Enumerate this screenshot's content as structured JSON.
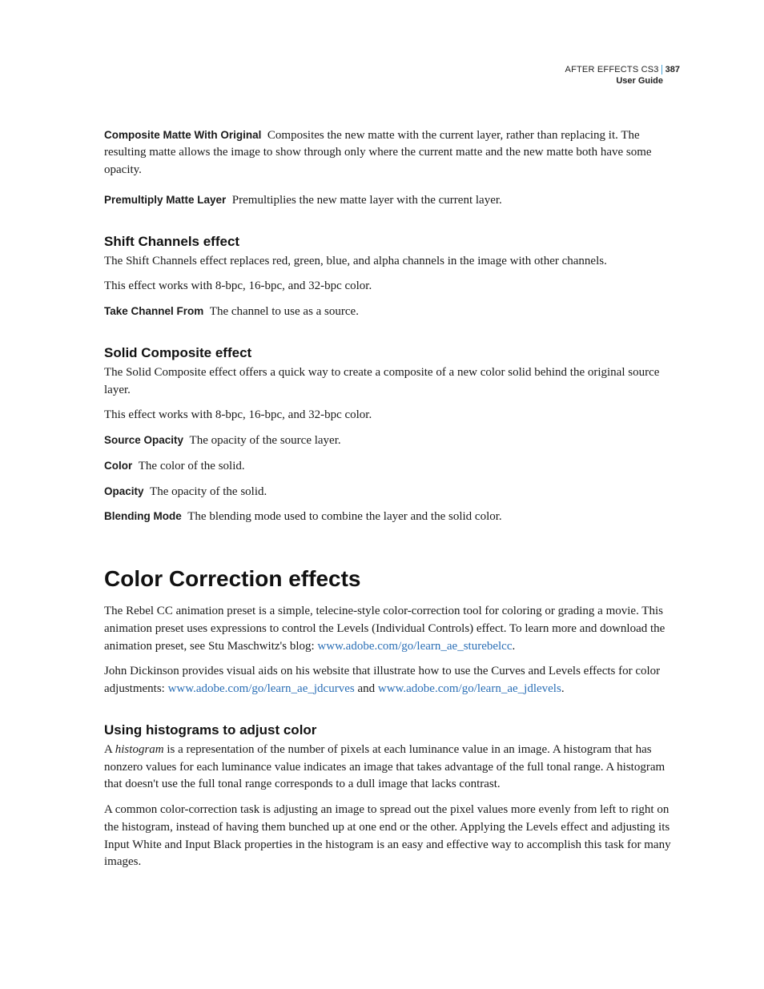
{
  "header": {
    "product": "AFTER EFFECTS CS3",
    "guide": "User Guide",
    "page_number": "387"
  },
  "intro_defs": [
    {
      "term": "Composite Matte With Original",
      "body": "Composites the new matte with the current layer, rather than replacing it. The resulting matte allows the image to show through only where the current matte and the new matte both have some opacity."
    },
    {
      "term": "Premultiply Matte Layer",
      "body": "Premultiplies the new matte layer with the current layer."
    }
  ],
  "shift_channels": {
    "title": "Shift Channels effect",
    "p1": "The Shift Channels effect replaces red, green, blue, and alpha channels in the image with other channels.",
    "p2": "This effect works with 8-bpc, 16-bpc, and 32-bpc color.",
    "defs": [
      {
        "term": "Take Channel From",
        "body": "The channel to use as a source."
      }
    ]
  },
  "solid_composite": {
    "title": "Solid Composite effect",
    "p1": "The Solid Composite effect offers a quick way to create a composite of a new color solid behind the original source layer.",
    "p2": "This effect works with 8-bpc, 16-bpc, and 32-bpc color.",
    "defs": [
      {
        "term": "Source Opacity",
        "body": "The opacity of the source layer."
      },
      {
        "term": "Color",
        "body": "The color of the solid."
      },
      {
        "term": "Opacity",
        "body": "The opacity of the solid."
      },
      {
        "term": "Blending Mode",
        "body": "The blending mode used to combine the layer and the solid color."
      }
    ]
  },
  "color_correction": {
    "title": "Color Correction effects",
    "p1_a": "The Rebel CC animation preset is a simple, telecine-style color-correction tool for coloring or grading a movie. This animation preset uses expressions to control the Levels (Individual Controls) effect. To learn more and download the animation preset, see Stu Maschwitz's blog: ",
    "p1_link": "www.adobe.com/go/learn_ae_sturebelcc",
    "p1_c": ".",
    "p2_a": "John Dickinson provides visual aids on his website that illustrate how to use the Curves and Levels effects for color adjustments: ",
    "p2_link1": "www.adobe.com/go/learn_ae_jdcurves",
    "p2_mid": " and ",
    "p2_link2": "www.adobe.com/go/learn_ae_jdlevels",
    "p2_c": "."
  },
  "histograms": {
    "title": "Using histograms to adjust color",
    "p1_a": "A ",
    "p1_em": "histogram",
    "p1_b": " is a representation of the number of pixels at each luminance value in an image. A histogram that has nonzero values for each luminance value indicates an image that takes advantage of the full tonal range. A histogram that doesn't use the full tonal range corresponds to a dull image that lacks contrast.",
    "p2": "A common color-correction task is adjusting an image to spread out the pixel values more evenly from left to right on the histogram, instead of having them bunched up at one end or the other. Applying the Levels effect and adjusting its Input White and Input Black properties in the histogram is an easy and effective way to accomplish this task for many images."
  }
}
